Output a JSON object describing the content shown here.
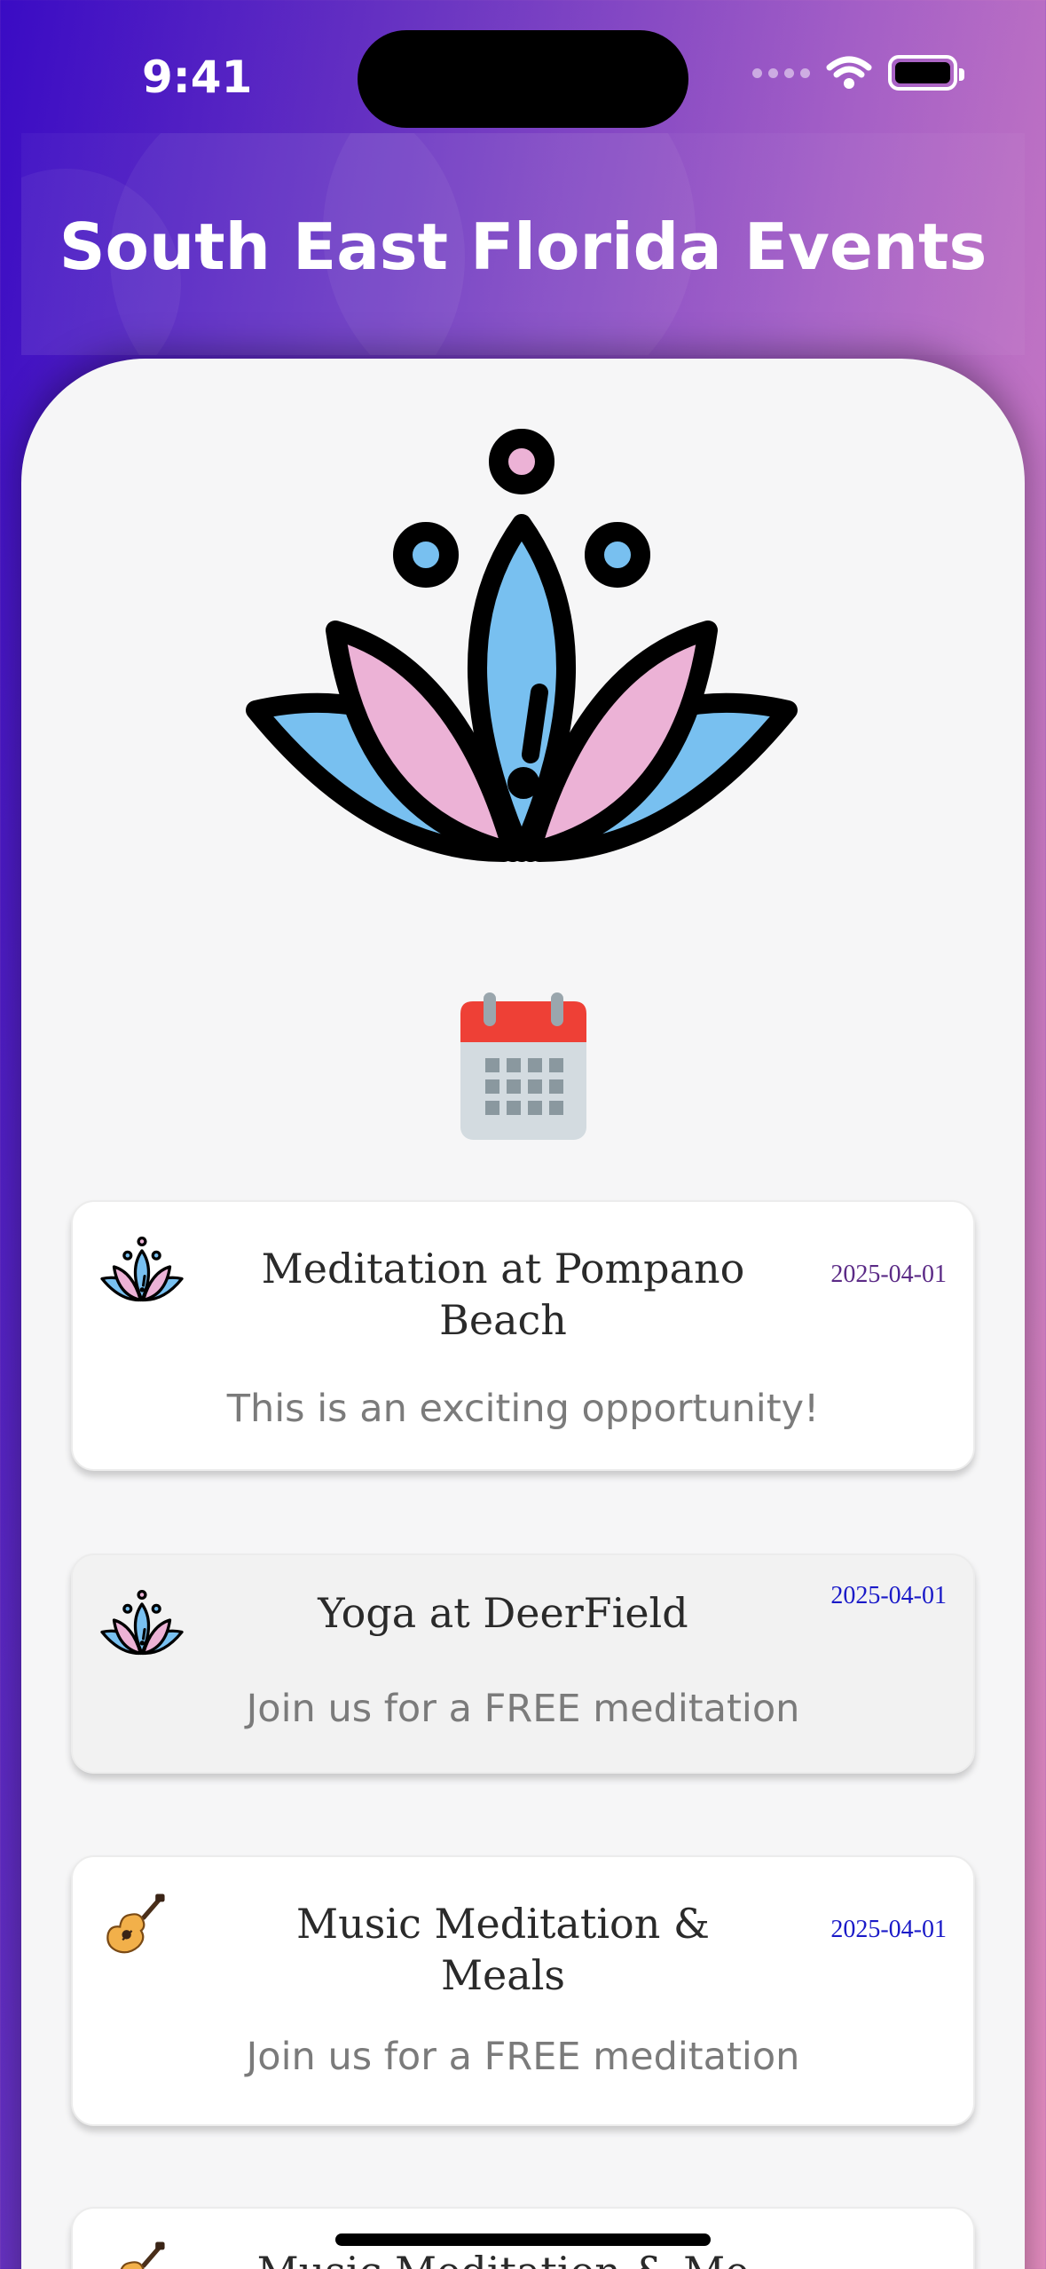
{
  "status_bar": {
    "time": "9:41"
  },
  "header": {
    "title": "South East Florida Events"
  },
  "icons": {
    "hero": "lotus-icon",
    "section": "calendar-icon"
  },
  "events": [
    {
      "name": "Meditation at Pompano Beach",
      "date": "2025-04-01",
      "description": "This is an exciting opportunity!",
      "icon": "lotus-icon",
      "date_color": "#5b2a86"
    },
    {
      "name": "Yoga at DeerField",
      "date": "2025-04-01",
      "description": "Join us for a FREE meditation",
      "icon": "lotus-icon",
      "date_color": "#1a1ac8"
    },
    {
      "name": "Music Meditation & Meals",
      "date": "2025-04-01",
      "description": "Join us for a FREE meditation",
      "icon": "guitar-icon",
      "date_color": "#1a1ac8"
    },
    {
      "name": "Music Meditation & Me",
      "date": "",
      "description": "",
      "icon": "guitar-icon",
      "date_color": "#1a1ac8"
    }
  ],
  "colors": {
    "lotus_blue": "#78c0f0",
    "lotus_pink": "#ecb2d6",
    "gradient_start": "#3a0bc4",
    "gradient_end": "#e68ec0"
  }
}
